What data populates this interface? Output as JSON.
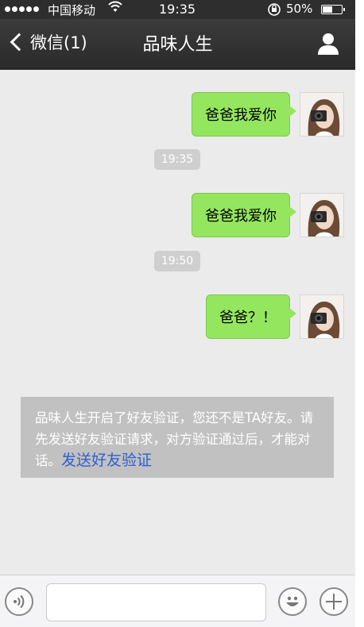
{
  "status_bar": {
    "carrier": "中国移动",
    "time": "19:35",
    "battery_percent": "50%",
    "battery_level": 0.5,
    "signal_icon": "signal-dots-icon",
    "wifi_icon": "wifi-icon",
    "lock_icon": "orientation-lock-icon"
  },
  "nav": {
    "back_label": "微信(1)",
    "title": "品味人生",
    "profile_icon": "person-icon"
  },
  "messages": [
    {
      "type": "sent",
      "text": "爸爸我爱你"
    },
    {
      "type": "time",
      "text": "19:35"
    },
    {
      "type": "sent",
      "text": "爸爸我爱你"
    },
    {
      "type": "time",
      "text": "19:50"
    },
    {
      "type": "sent",
      "text": "爸爸？！"
    }
  ],
  "notice": {
    "text": "品味人生开启了好友验证，您还不是TA好友。请先发送好友验证请求，对方验证通过后，才能对话。",
    "link": "发送好友验证"
  },
  "input_bar": {
    "voice_icon": "voice-icon",
    "input_value": "",
    "emoji_icon": "emoji-icon",
    "plus_icon": "plus-icon"
  },
  "colors": {
    "bubble": "#95e65f",
    "nav_background": "#2e2e2e",
    "chat_background": "#ebebeb",
    "notice_background": "#c1c1c1",
    "link": "#2f5fd1"
  }
}
